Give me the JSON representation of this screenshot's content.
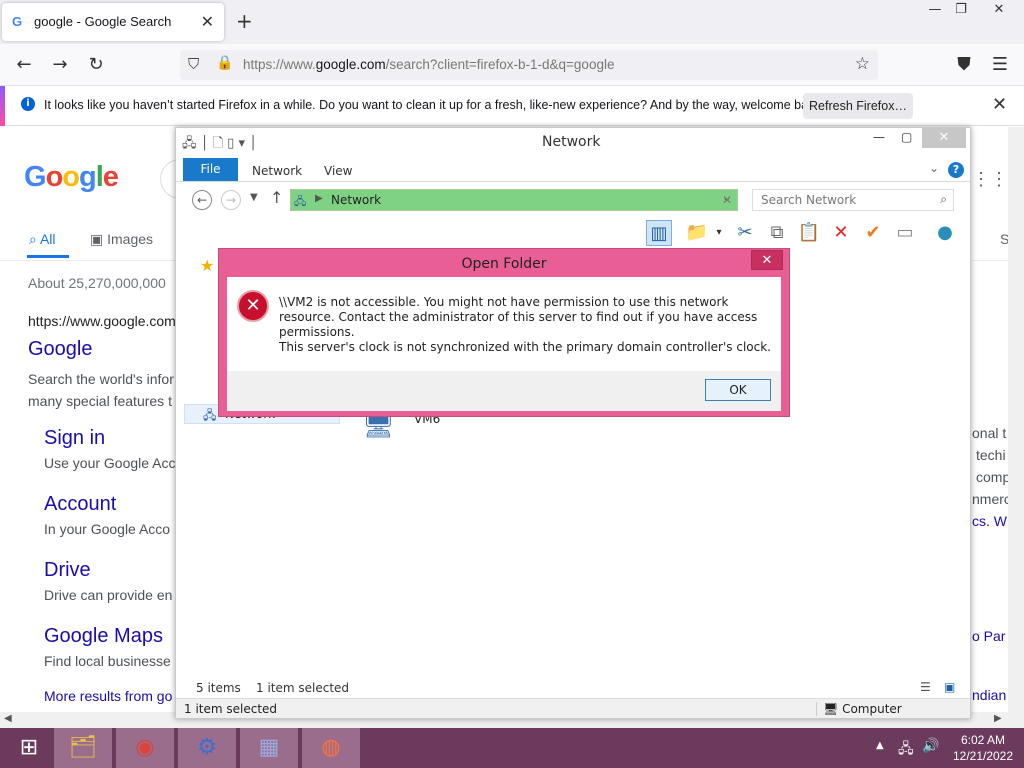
{
  "browser": {
    "tab": {
      "icon": "G",
      "title": "google - Google Search",
      "close": "✕"
    },
    "new_tab": "+",
    "window_controls": {
      "minimize": "—",
      "maximize": "❐",
      "close": "✕"
    },
    "nav": {
      "back": "←",
      "forward": "→",
      "reload": "↻"
    },
    "url": {
      "prefix": "https://www.",
      "domain": "google.com",
      "rest": "/search?client=firefox-b-1-d&q=google"
    },
    "icons": {
      "shield": "⛉",
      "lock": "🔒",
      "bookmark": "☆",
      "pocket": "⛊",
      "menu": "☰"
    },
    "notification": {
      "message": "It looks like you haven’t started Firefox in a while. Do you want to clean it up for a fresh, like-new experience? And by the way, welcome back!",
      "button": "Refresh Firefox…",
      "close": "✕"
    }
  },
  "google": {
    "logo": [
      "G",
      "o",
      "o",
      "g",
      "l",
      "e"
    ],
    "tabs": {
      "all": "All",
      "images": "Images",
      "cutoff": "S"
    },
    "result_count": "About 25,270,000,000",
    "result_url": "https://www.google.com",
    "result_title": "Google",
    "result_snippet": "Search the world's infor many special features t",
    "sitelinks": [
      {
        "title": "Sign in",
        "desc": "Use your Google Acc"
      },
      {
        "title": "Account",
        "desc": "In your Google Acco"
      },
      {
        "title": "Drive",
        "desc": "Drive can provide en"
      },
      {
        "title": "Google Maps",
        "desc": "Find local businesse"
      }
    ],
    "more_results": "More results from go",
    "right_fragments": [
      "onal t",
      "techi",
      "comp",
      "nmerc",
      "cs. W",
      "o Par",
      "ndian"
    ]
  },
  "explorer": {
    "title": "Network",
    "ribbon": {
      "file": "File",
      "tab_network": "Network",
      "tab_view": "View",
      "help": "?"
    },
    "address": {
      "location": "Network"
    },
    "search_placeholder": "Search Network",
    "nav_selected": "Network",
    "item_label": "VM6",
    "status": {
      "items": "5 items",
      "selected": "1 item selected"
    },
    "bottom": {
      "left": "1 item selected",
      "right": "Computer"
    }
  },
  "dialog": {
    "title": "Open Folder",
    "close": "✕",
    "message1": "\\\\VM2 is not accessible. You might not have permission to use this network resource. Contact the administrator of this server to find out if you have access permissions.",
    "message2": "This server's clock is not synchronized with the primary domain controller's clock.",
    "ok": "OK"
  },
  "taskbar": {
    "clock_time": "6:02 AM",
    "clock_date": "12/21/2022"
  },
  "colors": {
    "dialog_frame": "#e95f95",
    "taskbar": "#6b3a5c",
    "address_highlight": "#7fd283",
    "ribbon_file": "#1979ca"
  }
}
